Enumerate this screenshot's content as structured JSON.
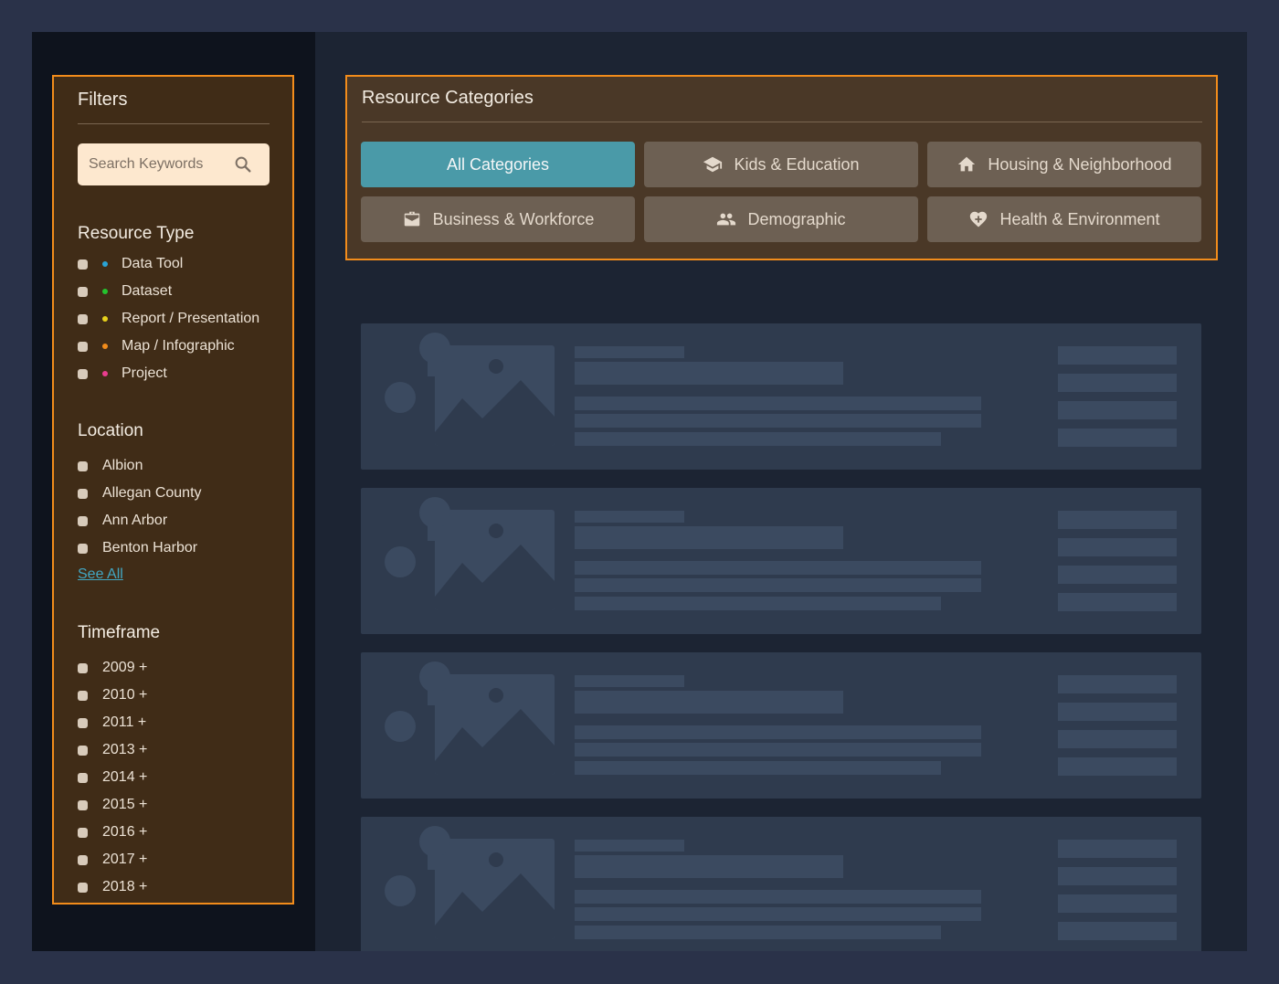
{
  "filters": {
    "title": "Filters",
    "search_placeholder": "Search Keywords",
    "resource_type": {
      "title": "Resource Type",
      "items": [
        {
          "label": "Data Tool",
          "color": "#2aa4d6"
        },
        {
          "label": "Dataset",
          "color": "#25c22e"
        },
        {
          "label": "Report / Presentation",
          "color": "#e8d21c"
        },
        {
          "label": "Map / Infographic",
          "color": "#f28c1b"
        },
        {
          "label": "Project",
          "color": "#ea3d8f"
        }
      ]
    },
    "location": {
      "title": "Location",
      "items": [
        "Albion",
        "Allegan County",
        "Ann Arbor",
        "Benton Harbor"
      ],
      "see_all": "See All"
    },
    "timeframe": {
      "title": "Timeframe",
      "items": [
        "2009 +",
        "2010 +",
        "2011 +",
        "2013 +",
        "2014 +",
        "2015 +",
        "2016 +",
        "2017 +",
        "2018 +"
      ]
    }
  },
  "categories": {
    "title": "Resource Categories",
    "buttons": [
      {
        "label": "All Categories",
        "icon": "none",
        "active": true
      },
      {
        "label": "Kids & Education",
        "icon": "graduation-cap-icon",
        "active": false
      },
      {
        "label": "Housing & Neighborhood",
        "icon": "home-icon",
        "active": false
      },
      {
        "label": "Business & Workforce",
        "icon": "briefcase-icon",
        "active": false
      },
      {
        "label": "Demographic",
        "icon": "people-icon",
        "active": false
      },
      {
        "label": "Health & Environment",
        "icon": "heart-plus-icon",
        "active": false
      }
    ]
  },
  "results": {
    "placeholder_cards": 4
  },
  "colors": {
    "accent_orange": "#f28c1b",
    "active_category": "#4a9aa8",
    "link": "#42a6c2"
  }
}
